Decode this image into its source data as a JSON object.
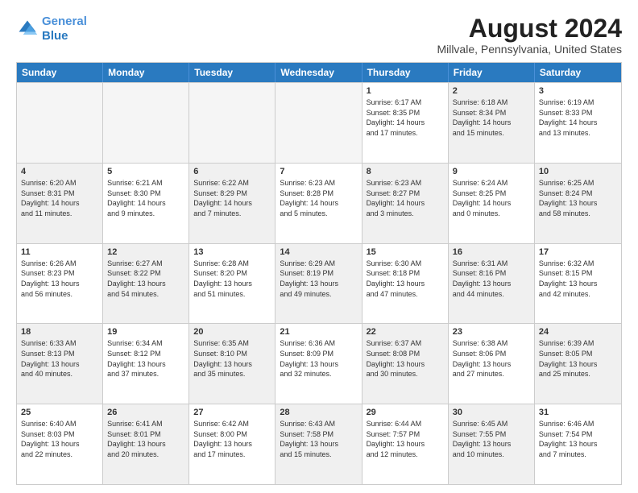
{
  "header": {
    "logo_line1": "General",
    "logo_line2": "Blue",
    "main_title": "August 2024",
    "subtitle": "Millvale, Pennsylvania, United States"
  },
  "weekdays": [
    "Sunday",
    "Monday",
    "Tuesday",
    "Wednesday",
    "Thursday",
    "Friday",
    "Saturday"
  ],
  "rows": [
    [
      {
        "day": "",
        "info": "",
        "empty": true
      },
      {
        "day": "",
        "info": "",
        "empty": true
      },
      {
        "day": "",
        "info": "",
        "empty": true
      },
      {
        "day": "",
        "info": "",
        "empty": true
      },
      {
        "day": "1",
        "info": "Sunrise: 6:17 AM\nSunset: 8:35 PM\nDaylight: 14 hours\nand 17 minutes."
      },
      {
        "day": "2",
        "info": "Sunrise: 6:18 AM\nSunset: 8:34 PM\nDaylight: 14 hours\nand 15 minutes.",
        "shaded": true
      },
      {
        "day": "3",
        "info": "Sunrise: 6:19 AM\nSunset: 8:33 PM\nDaylight: 14 hours\nand 13 minutes."
      }
    ],
    [
      {
        "day": "4",
        "info": "Sunrise: 6:20 AM\nSunset: 8:31 PM\nDaylight: 14 hours\nand 11 minutes.",
        "shaded": true
      },
      {
        "day": "5",
        "info": "Sunrise: 6:21 AM\nSunset: 8:30 PM\nDaylight: 14 hours\nand 9 minutes."
      },
      {
        "day": "6",
        "info": "Sunrise: 6:22 AM\nSunset: 8:29 PM\nDaylight: 14 hours\nand 7 minutes.",
        "shaded": true
      },
      {
        "day": "7",
        "info": "Sunrise: 6:23 AM\nSunset: 8:28 PM\nDaylight: 14 hours\nand 5 minutes."
      },
      {
        "day": "8",
        "info": "Sunrise: 6:23 AM\nSunset: 8:27 PM\nDaylight: 14 hours\nand 3 minutes.",
        "shaded": true
      },
      {
        "day": "9",
        "info": "Sunrise: 6:24 AM\nSunset: 8:25 PM\nDaylight: 14 hours\nand 0 minutes."
      },
      {
        "day": "10",
        "info": "Sunrise: 6:25 AM\nSunset: 8:24 PM\nDaylight: 13 hours\nand 58 minutes.",
        "shaded": true
      }
    ],
    [
      {
        "day": "11",
        "info": "Sunrise: 6:26 AM\nSunset: 8:23 PM\nDaylight: 13 hours\nand 56 minutes."
      },
      {
        "day": "12",
        "info": "Sunrise: 6:27 AM\nSunset: 8:22 PM\nDaylight: 13 hours\nand 54 minutes.",
        "shaded": true
      },
      {
        "day": "13",
        "info": "Sunrise: 6:28 AM\nSunset: 8:20 PM\nDaylight: 13 hours\nand 51 minutes."
      },
      {
        "day": "14",
        "info": "Sunrise: 6:29 AM\nSunset: 8:19 PM\nDaylight: 13 hours\nand 49 minutes.",
        "shaded": true
      },
      {
        "day": "15",
        "info": "Sunrise: 6:30 AM\nSunset: 8:18 PM\nDaylight: 13 hours\nand 47 minutes."
      },
      {
        "day": "16",
        "info": "Sunrise: 6:31 AM\nSunset: 8:16 PM\nDaylight: 13 hours\nand 44 minutes.",
        "shaded": true
      },
      {
        "day": "17",
        "info": "Sunrise: 6:32 AM\nSunset: 8:15 PM\nDaylight: 13 hours\nand 42 minutes."
      }
    ],
    [
      {
        "day": "18",
        "info": "Sunrise: 6:33 AM\nSunset: 8:13 PM\nDaylight: 13 hours\nand 40 minutes.",
        "shaded": true
      },
      {
        "day": "19",
        "info": "Sunrise: 6:34 AM\nSunset: 8:12 PM\nDaylight: 13 hours\nand 37 minutes."
      },
      {
        "day": "20",
        "info": "Sunrise: 6:35 AM\nSunset: 8:10 PM\nDaylight: 13 hours\nand 35 minutes.",
        "shaded": true
      },
      {
        "day": "21",
        "info": "Sunrise: 6:36 AM\nSunset: 8:09 PM\nDaylight: 13 hours\nand 32 minutes."
      },
      {
        "day": "22",
        "info": "Sunrise: 6:37 AM\nSunset: 8:08 PM\nDaylight: 13 hours\nand 30 minutes.",
        "shaded": true
      },
      {
        "day": "23",
        "info": "Sunrise: 6:38 AM\nSunset: 8:06 PM\nDaylight: 13 hours\nand 27 minutes."
      },
      {
        "day": "24",
        "info": "Sunrise: 6:39 AM\nSunset: 8:05 PM\nDaylight: 13 hours\nand 25 minutes.",
        "shaded": true
      }
    ],
    [
      {
        "day": "25",
        "info": "Sunrise: 6:40 AM\nSunset: 8:03 PM\nDaylight: 13 hours\nand 22 minutes."
      },
      {
        "day": "26",
        "info": "Sunrise: 6:41 AM\nSunset: 8:01 PM\nDaylight: 13 hours\nand 20 minutes.",
        "shaded": true
      },
      {
        "day": "27",
        "info": "Sunrise: 6:42 AM\nSunset: 8:00 PM\nDaylight: 13 hours\nand 17 minutes."
      },
      {
        "day": "28",
        "info": "Sunrise: 6:43 AM\nSunset: 7:58 PM\nDaylight: 13 hours\nand 15 minutes.",
        "shaded": true
      },
      {
        "day": "29",
        "info": "Sunrise: 6:44 AM\nSunset: 7:57 PM\nDaylight: 13 hours\nand 12 minutes."
      },
      {
        "day": "30",
        "info": "Sunrise: 6:45 AM\nSunset: 7:55 PM\nDaylight: 13 hours\nand 10 minutes.",
        "shaded": true
      },
      {
        "day": "31",
        "info": "Sunrise: 6:46 AM\nSunset: 7:54 PM\nDaylight: 13 hours\nand 7 minutes."
      }
    ]
  ]
}
